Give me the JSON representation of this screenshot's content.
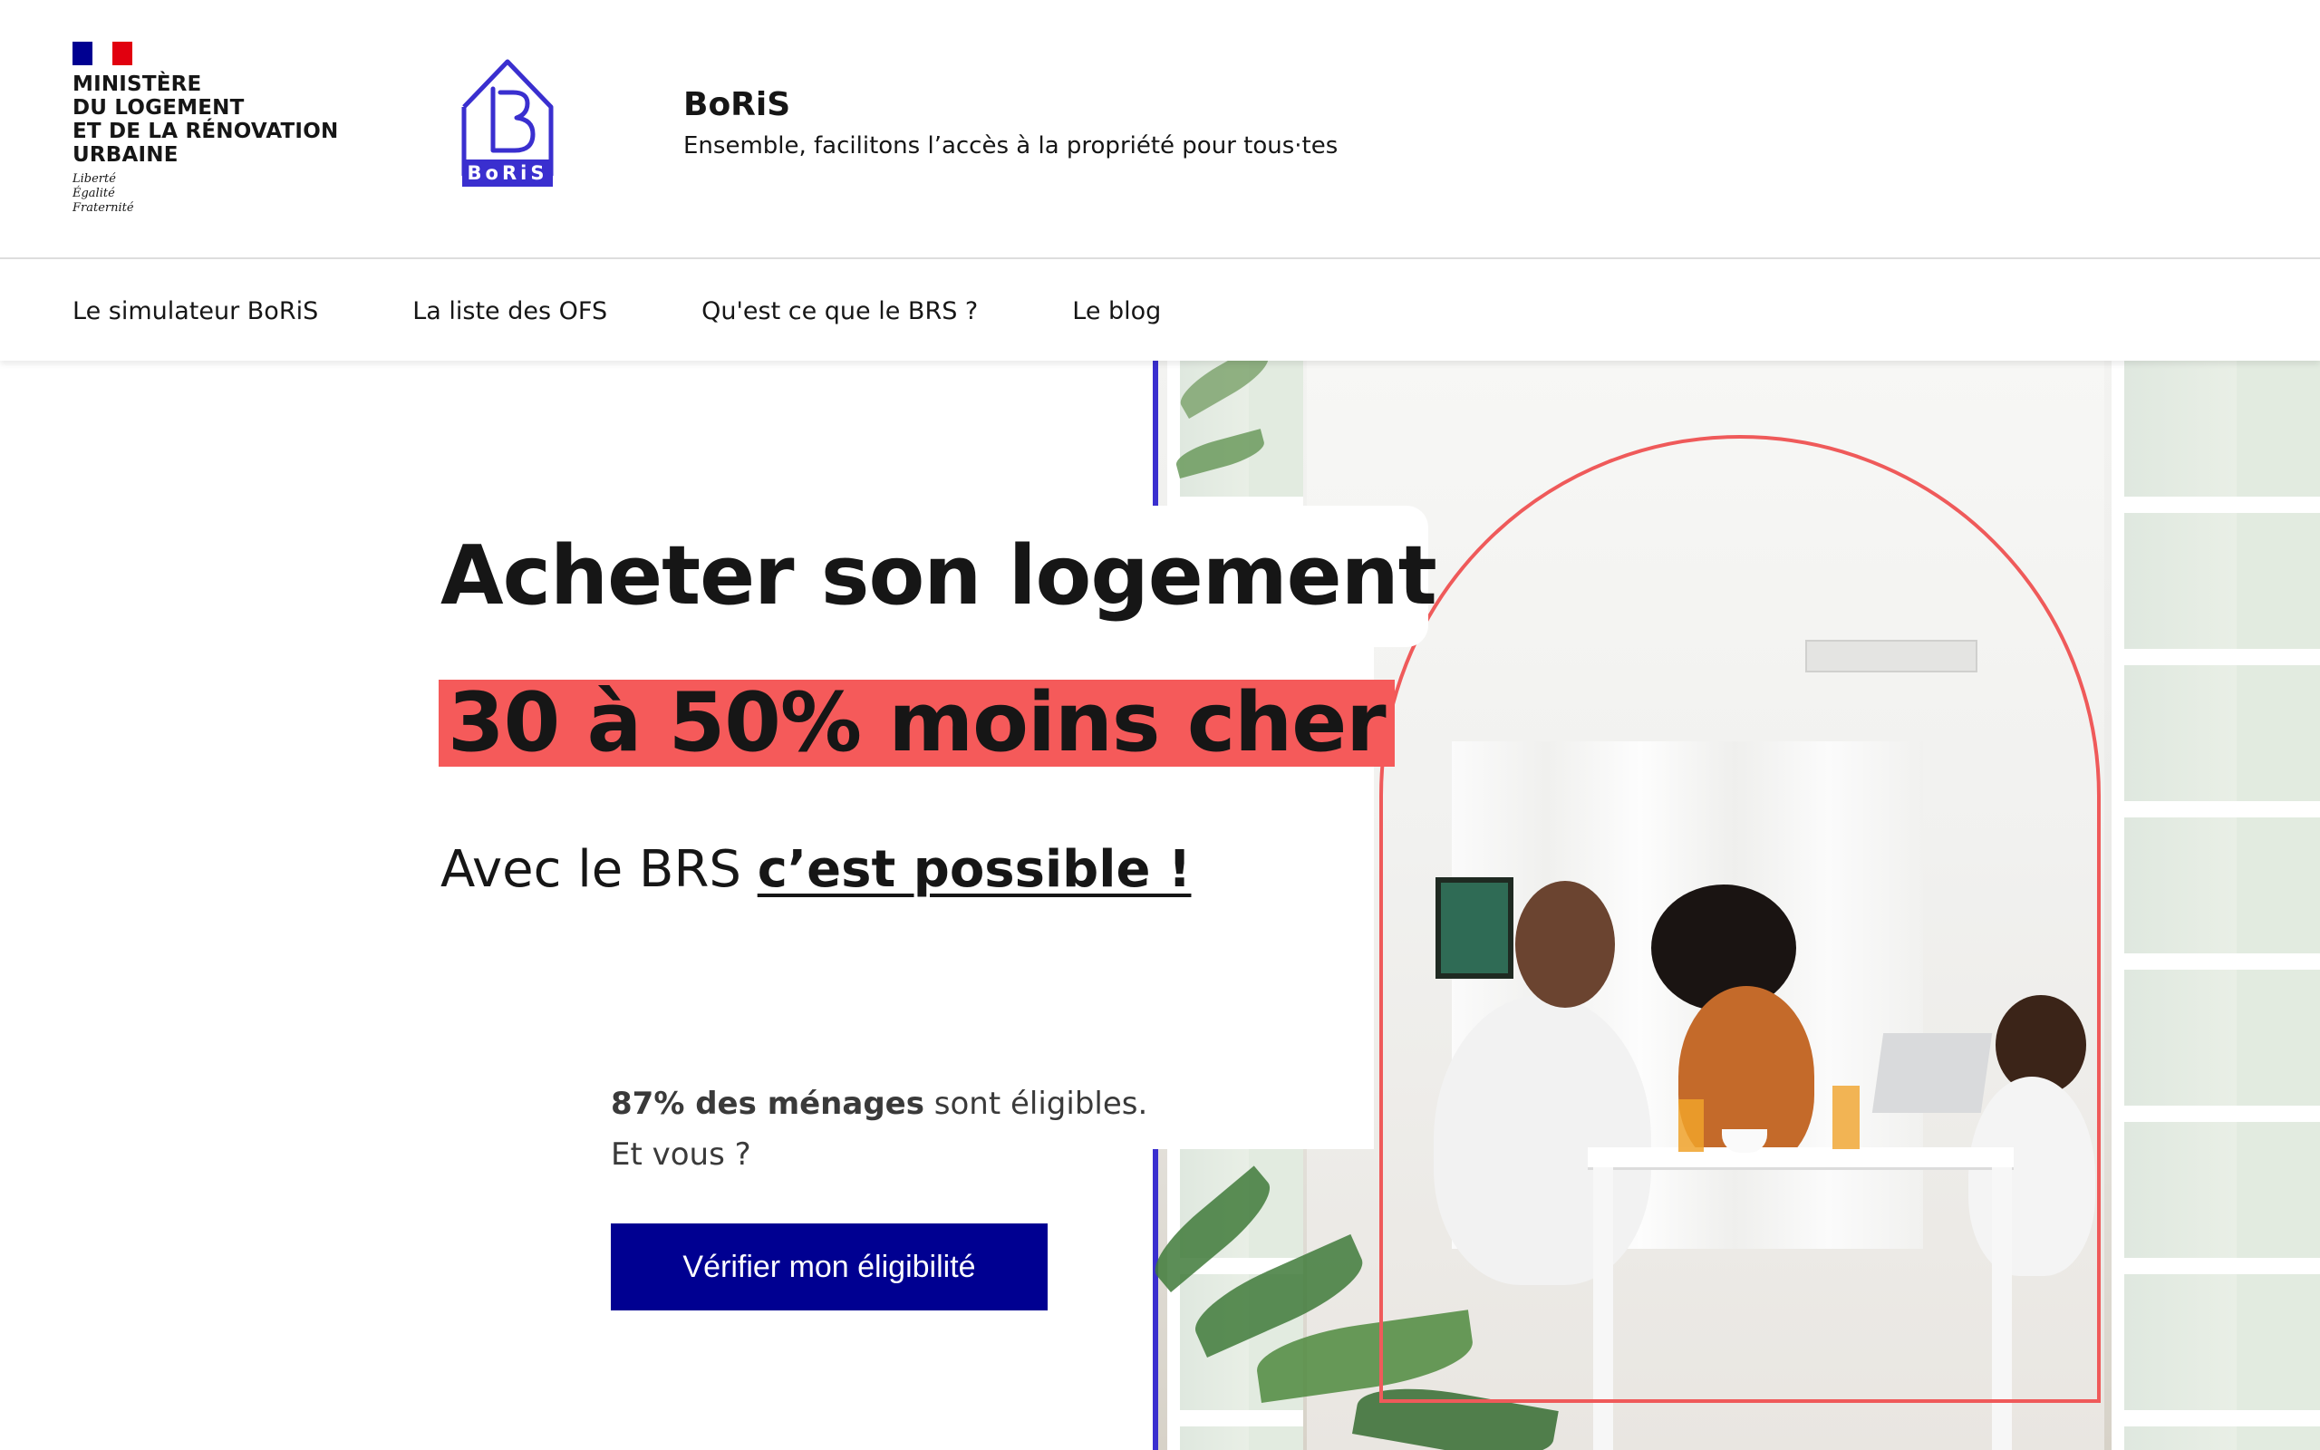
{
  "header": {
    "ministry_lines": [
      "MINISTÈRE",
      "DU LOGEMENT",
      "ET DE LA RÉNOVATION",
      "URBAINE"
    ],
    "motto_lines": [
      "Liberté",
      "Égalité",
      "Fraternité"
    ],
    "boris_logo_text": "BoRiS",
    "service_title": "BoRiS",
    "service_tagline": "Ensemble, facilitons l’accès à la propriété pour tous·tes"
  },
  "nav": {
    "items": [
      {
        "label": "Le simulateur BoRiS"
      },
      {
        "label": "La liste des OFS"
      },
      {
        "label": "Qu'est ce que le BRS ?"
      },
      {
        "label": "Le blog"
      }
    ]
  },
  "hero": {
    "title": "Acheter son logement",
    "highlight": "30 à 50% moins cher",
    "subtitle_prefix": "Avec le BRS ",
    "subtitle_link": "c’est possible !",
    "eligibility_bold": "87% des ménages",
    "eligibility_rest": " sont éligibles.",
    "eligibility_question": "Et vous ?",
    "cta_label": "Vérifier mon éligibilité",
    "photo_icon": "family-breakfast-photo"
  },
  "colors": {
    "primary": "#000091",
    "accent_red": "#f55a5a",
    "arch_red": "#ef5a5a",
    "logo_purple": "#3a2fcf"
  }
}
